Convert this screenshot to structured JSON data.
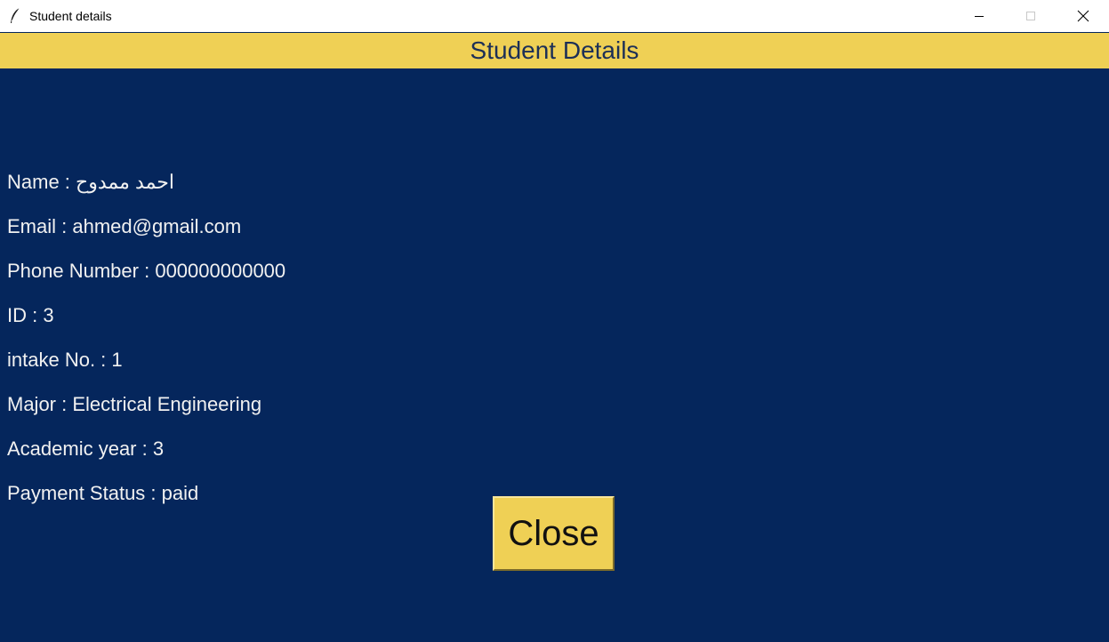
{
  "window": {
    "title": "Student details",
    "icon": "feather-icon",
    "controls": {
      "minimize": "minimize-icon",
      "maximize": "maximize-icon",
      "close": "close-icon"
    }
  },
  "header": {
    "title": "Student Details"
  },
  "separator": " : ",
  "fields": [
    {
      "label": "Name",
      "value": "احمد ممدوح"
    },
    {
      "label": "Email",
      "value": "ahmed@gmail.com"
    },
    {
      "label": "Phone Number",
      "value": "000000000000"
    },
    {
      "label": "ID",
      "value": "3"
    },
    {
      "label": "intake No.",
      "value": "1"
    },
    {
      "label": "Major",
      "value": "Electrical Engineering"
    },
    {
      "label": "Academic year",
      "value": "3"
    },
    {
      "label": "Payment Status",
      "value": "paid"
    }
  ],
  "actions": {
    "close_label": "Close"
  },
  "colors": {
    "background": "#05265c",
    "accent": "#efd055",
    "header_text": "#1c2f57",
    "body_text": "#f1f1f1"
  }
}
